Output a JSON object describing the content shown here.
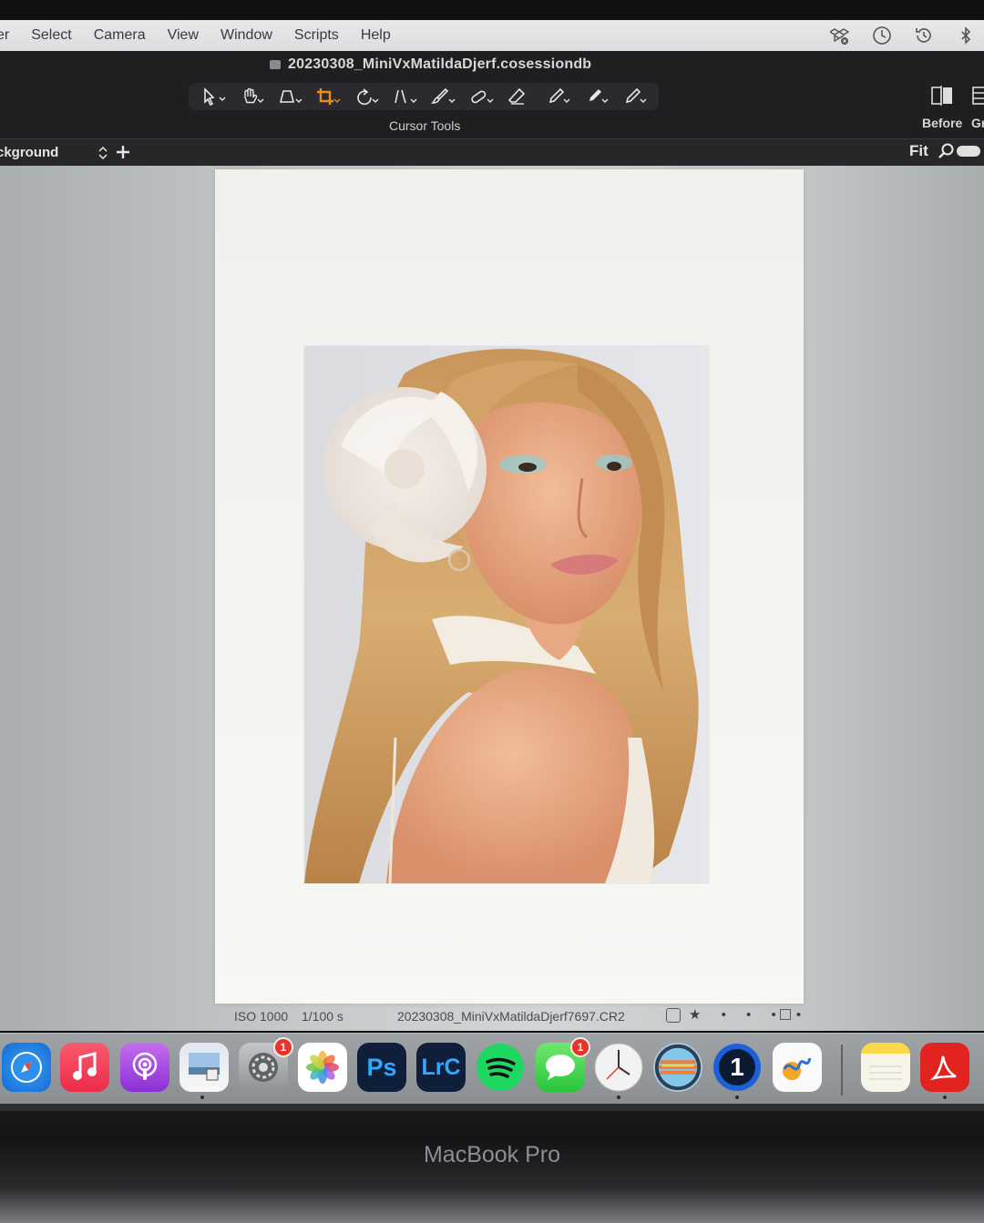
{
  "menu": {
    "items": [
      "er",
      "Select",
      "Camera",
      "View",
      "Window",
      "Scripts",
      "Help"
    ]
  },
  "window": {
    "document_title": "20230308_MiniVxMatildaDjerf.cosessiondb"
  },
  "toolbar": {
    "caption": "Cursor Tools",
    "before_label": "Before",
    "grid_label": "Gr",
    "tools": [
      "select-cursor",
      "hand-pan",
      "keystone",
      "crop",
      "rotate",
      "straighten",
      "brush",
      "heal",
      "erase",
      "picker",
      "draw-mask",
      "edit-mask"
    ]
  },
  "layer": {
    "name": "ckground",
    "zoom_mode": "Fit"
  },
  "status": {
    "iso": "ISO 1000",
    "shutter": "1/100 s",
    "filename": "20230308_MiniVxMatildaDjerf7697.CR2",
    "rating_stars": "★ • • • •"
  },
  "dock": {
    "apps": [
      "Safari",
      "Music",
      "Podcasts",
      "Preview",
      "System Settings",
      "Photos",
      "Photoshop",
      "Lightroom Classic",
      "Spotify",
      "Messages",
      "Clock",
      "Capture One",
      "1Password",
      "Freeform",
      "Notes",
      "Acrobat"
    ],
    "settings_badge": "1",
    "messages_badge": "1",
    "ps_label": "Ps",
    "lrc_label": "LrC",
    "onepass_label": "1"
  },
  "hardware": {
    "label": "MacBook Pro"
  },
  "colors": {
    "accent_crop": "#f08a1c",
    "menubar": "#e3e3e6",
    "toolbar": "#1f1f22",
    "viewer_bg": "#c5c9ca"
  }
}
